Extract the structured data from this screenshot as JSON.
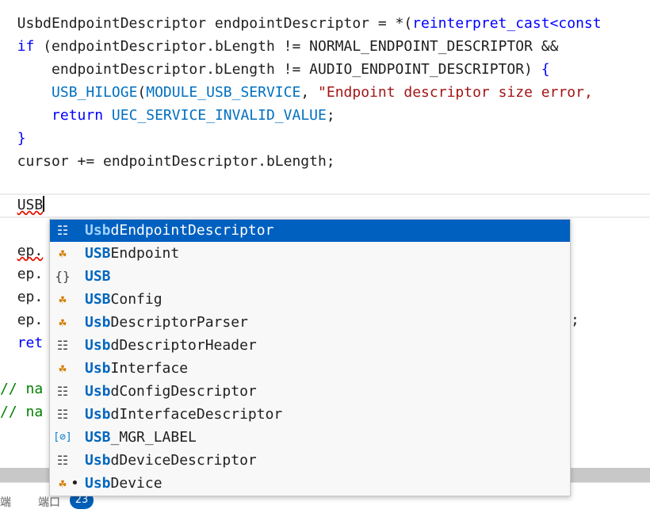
{
  "code_top": [
    {
      "parts": [
        {
          "t": "  UsbdEndpointDescriptor endpointDescriptor = *(",
          "c": ""
        },
        {
          "t": "reinterpret_cast",
          "c": "kw"
        },
        {
          "t": "<const",
          "c": "kw"
        }
      ]
    },
    {
      "parts": [
        {
          "t": "  ",
          "c": ""
        },
        {
          "t": "if",
          "c": "kw"
        },
        {
          "t": " (endpointDescriptor.bLength != NORMAL_ENDPOINT_DESCRIPTOR &&",
          "c": ""
        }
      ]
    },
    {
      "parts": [
        {
          "t": "      endpointDescriptor.bLength != AUDIO_ENDPOINT_DESCRIPTOR) ",
          "c": ""
        },
        {
          "t": "{",
          "c": "kw"
        }
      ]
    },
    {
      "parts": [
        {
          "t": "      ",
          "c": ""
        },
        {
          "t": "USB_HILOGE",
          "c": "macro"
        },
        {
          "t": "(",
          "c": ""
        },
        {
          "t": "MODULE_USB_SERVICE",
          "c": "macro"
        },
        {
          "t": ", ",
          "c": ""
        },
        {
          "t": "\"Endpoint descriptor size error,",
          "c": "str"
        }
      ]
    },
    {
      "parts": [
        {
          "t": "      ",
          "c": ""
        },
        {
          "t": "return",
          "c": "kw"
        },
        {
          "t": " ",
          "c": ""
        },
        {
          "t": "UEC_SERVICE_INVALID_VALUE",
          "c": "macro"
        },
        {
          "t": ";",
          "c": ""
        }
      ]
    },
    {
      "parts": [
        {
          "t": "  ",
          "c": ""
        },
        {
          "t": "}",
          "c": "kw"
        }
      ]
    },
    {
      "parts": [
        {
          "t": "  cursor += endpointDescriptor.bLength;",
          "c": ""
        }
      ]
    }
  ],
  "typing_line": "USB",
  "code_under": [
    {
      "text": "ep.",
      "squiggle": true
    },
    {
      "text": "ep.",
      "squiggle": false
    },
    {
      "text": "ep.",
      "squiggle": false
    },
    {
      "text": "ep.",
      "squiggle": false
    },
    {
      "text": "ret",
      "squiggle": false,
      "kw": true
    },
    {
      "text": "",
      "squiggle": false
    },
    {
      "text": "// na",
      "squiggle": false,
      "cmt": true,
      "indent": 0
    },
    {
      "text": "// na",
      "squiggle": false,
      "cmt": true,
      "indent": 0
    }
  ],
  "trailing_semicolon": ";",
  "suggestions": [
    {
      "icon": "struct",
      "match": "Usb",
      "rest": "dEndpointDescriptor",
      "selected": true
    },
    {
      "icon": "class",
      "match": "USB",
      "rest": "Endpoint",
      "selected": false
    },
    {
      "icon": "namespace",
      "match": "USB",
      "rest": "",
      "selected": false
    },
    {
      "icon": "class",
      "match": "USB",
      "rest": "Config",
      "selected": false
    },
    {
      "icon": "class",
      "match": "Usb",
      "rest": "DescriptorParser",
      "selected": false
    },
    {
      "icon": "struct",
      "match": "Usb",
      "rest": "dDescriptorHeader",
      "selected": false
    },
    {
      "icon": "class",
      "match": "Usb",
      "rest": "Interface",
      "selected": false
    },
    {
      "icon": "struct",
      "match": "Usb",
      "rest": "dConfigDescriptor",
      "selected": false
    },
    {
      "icon": "struct",
      "match": "Usb",
      "rest": "dInterfaceDescriptor",
      "selected": false
    },
    {
      "icon": "constant",
      "match": "USB",
      "rest": "_MGR_LABEL",
      "selected": false
    },
    {
      "icon": "struct",
      "match": "Usb",
      "rest": "dDeviceDescriptor",
      "selected": false
    },
    {
      "icon": "class",
      "match": "Usb",
      "rest": "Device",
      "selected": false,
      "dot": "•"
    }
  ],
  "bottom_tabs": {
    "terminal_partial": "端",
    "ports_label": "端口",
    "ports_count": "23"
  }
}
